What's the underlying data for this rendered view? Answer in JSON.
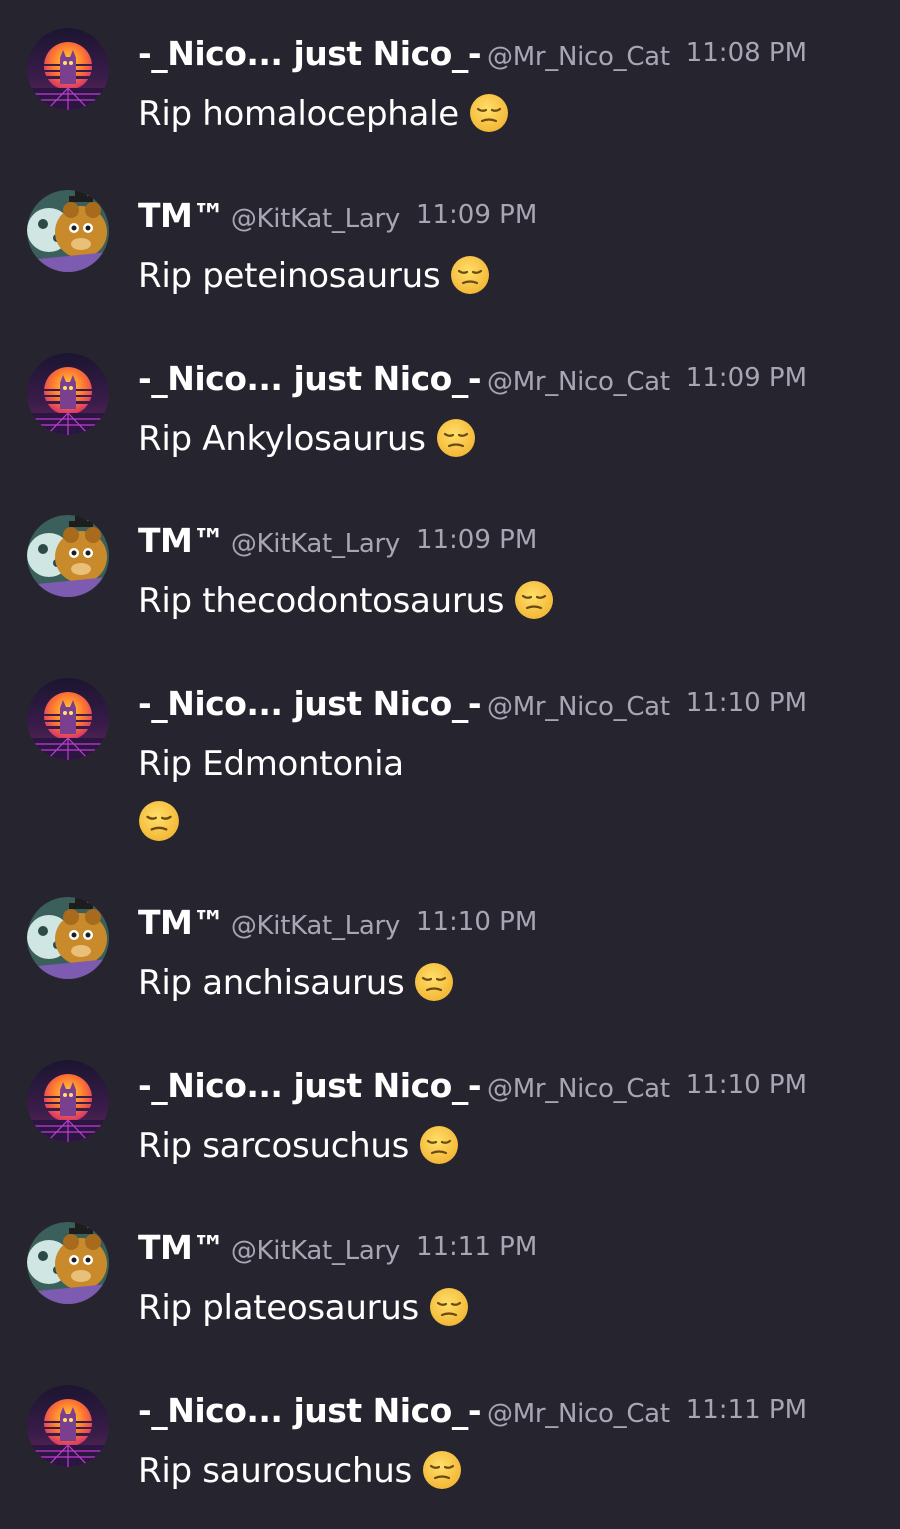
{
  "messages": [
    {
      "author": "-_Nico... just Nico_-",
      "handle": "@Mr_Nico_Cat",
      "time": "11:08 PM",
      "text": "Rip homalocephale",
      "avatar_icon": "synthwave-cat-avatar",
      "emoji": "pensive-face-emoji"
    },
    {
      "author": "TM™",
      "handle": "@KitKat_Lary",
      "time": "11:09 PM",
      "text": "Rip peteinosaurus",
      "avatar_icon": "animatronic-bear-avatar",
      "emoji": "pensive-face-emoji"
    },
    {
      "author": "-_Nico... just Nico_-",
      "handle": "@Mr_Nico_Cat",
      "time": "11:09 PM",
      "text": "Rip Ankylosaurus",
      "avatar_icon": "synthwave-cat-avatar",
      "emoji": "pensive-face-emoji"
    },
    {
      "author": "TM™",
      "handle": "@KitKat_Lary",
      "time": "11:09 PM",
      "text": "Rip thecodontosaurus",
      "avatar_icon": "animatronic-bear-avatar",
      "emoji": "pensive-face-emoji"
    },
    {
      "author": "-_Nico... just Nico_-",
      "handle": "@Mr_Nico_Cat",
      "time": "11:10 PM",
      "text": "Rip Edmontonia",
      "avatar_icon": "synthwave-cat-avatar",
      "emoji": "pensive-face-emoji"
    },
    {
      "author": "TM™",
      "handle": "@KitKat_Lary",
      "time": "11:10 PM",
      "text": "Rip anchisaurus",
      "avatar_icon": "animatronic-bear-avatar",
      "emoji": "pensive-face-emoji"
    },
    {
      "author": "-_Nico... just Nico_-",
      "handle": "@Mr_Nico_Cat",
      "time": "11:10 PM",
      "text": "Rip sarcosuchus",
      "avatar_icon": "synthwave-cat-avatar",
      "emoji": "pensive-face-emoji"
    },
    {
      "author": "TM™",
      "handle": "@KitKat_Lary",
      "time": "11:11 PM",
      "text": "Rip plateosaurus",
      "avatar_icon": "animatronic-bear-avatar",
      "emoji": "pensive-face-emoji"
    },
    {
      "author": "-_Nico... just Nico_-",
      "handle": "@Mr_Nico_Cat",
      "time": "11:11 PM",
      "text": "Rip saurosuchus",
      "avatar_icon": "synthwave-cat-avatar",
      "emoji": "pensive-face-emoji"
    }
  ],
  "colors": {
    "background": "#26252f",
    "name": "#ffffff",
    "meta": "#a7a6b4",
    "emoji_face": "#f7c542"
  }
}
